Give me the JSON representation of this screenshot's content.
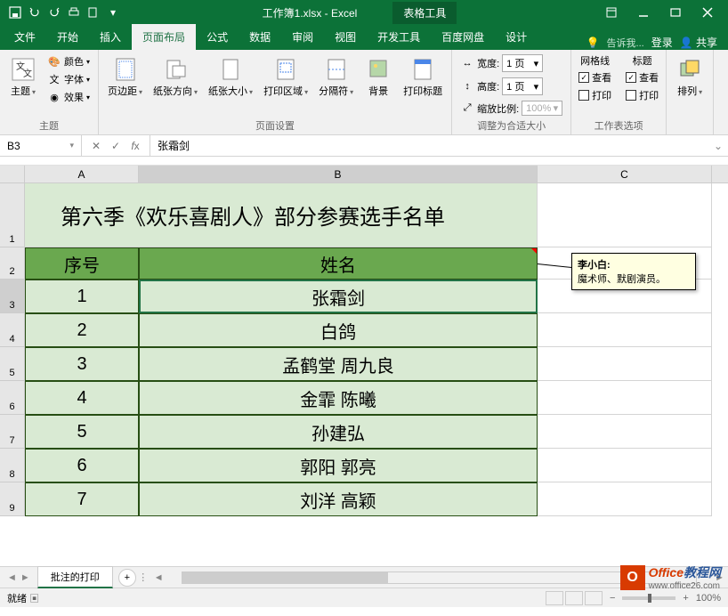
{
  "titlebar": {
    "filename": "工作簿1.xlsx - Excel",
    "tool_context": "表格工具"
  },
  "tabs": {
    "file": "文件",
    "home": "开始",
    "insert": "插入",
    "page_layout": "页面布局",
    "formulas": "公式",
    "data": "数据",
    "review": "审阅",
    "view": "视图",
    "developer": "开发工具",
    "baidu": "百度网盘",
    "design": "设计",
    "tell_me": "告诉我...",
    "login": "登录",
    "share": "共享"
  },
  "ribbon": {
    "themes": {
      "label": "主题",
      "btn": "主题",
      "colors": "颜色",
      "fonts": "字体",
      "effects": "效果"
    },
    "page_setup": {
      "label": "页面设置",
      "margins": "页边距",
      "orientation": "纸张方向",
      "size": "纸张大小",
      "print_area": "打印区域",
      "breaks": "分隔符",
      "background": "背景",
      "print_titles": "打印标题"
    },
    "scale": {
      "label": "调整为合适大小",
      "width": "宽度:",
      "height": "高度:",
      "scale_lbl": "缩放比例:",
      "width_val": "1 页",
      "height_val": "1 页",
      "scale_val": "100%"
    },
    "sheet_opts": {
      "label": "工作表选项",
      "gridlines": "网格线",
      "headings": "标题",
      "view": "查看",
      "print": "打印"
    },
    "arrange": {
      "label": "排列",
      "btn": "排列"
    }
  },
  "formula_bar": {
    "name_box": "B3",
    "formula": "张霜剑"
  },
  "columns": [
    "A",
    "B",
    "C"
  ],
  "sheet": {
    "title": "第六季《欢乐喜剧人》部分参赛选手名单",
    "header_a": "序号",
    "header_b": "姓名",
    "rows": [
      {
        "n": "1",
        "name": "张霜剑"
      },
      {
        "n": "2",
        "name": "白鸽"
      },
      {
        "n": "3",
        "name": "孟鹤堂  周九良"
      },
      {
        "n": "4",
        "name": "金霏  陈曦"
      },
      {
        "n": "5",
        "name": "孙建弘"
      },
      {
        "n": "6",
        "name": "郭阳  郭亮"
      },
      {
        "n": "7",
        "name": "刘洋  高颖"
      }
    ]
  },
  "comment": {
    "author": "李小白",
    "text": "魔术师、默剧演员。"
  },
  "sheet_tab": "批注的打印",
  "status": {
    "ready": "就绪",
    "macro": "",
    "zoom": "100%"
  },
  "watermark": {
    "brand1": "Office",
    "brand2": "教程网",
    "url": "www.office26.com"
  }
}
